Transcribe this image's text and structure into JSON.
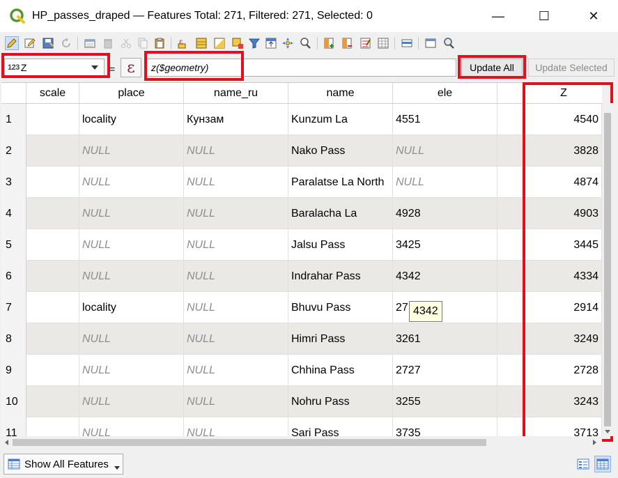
{
  "window": {
    "title": "HP_passes_draped — Features Total: 271, Filtered: 271, Selected: 0",
    "minimize_glyph": "—",
    "maximize_glyph": "☐",
    "close_glyph": "✕"
  },
  "calculator": {
    "field_type": "123",
    "field_name": "Z",
    "equals": "=",
    "expression_button": "ε",
    "expression": "z($geometry)",
    "update_all_label": "Update All",
    "update_selected_label": "Update Selected"
  },
  "table": {
    "columns": [
      "scale",
      "place",
      "name_ru",
      "name",
      "ele",
      "",
      "Z"
    ],
    "rows": [
      {
        "num": "1",
        "scale": "",
        "place": "locality",
        "name_ru": "Кунзам",
        "name": "Kunzum La",
        "ele": "4551",
        "z": "4540"
      },
      {
        "num": "2",
        "scale": "",
        "place": "NULL",
        "name_ru": "NULL",
        "name": "Nako Pass",
        "ele": "NULL",
        "z": "3828"
      },
      {
        "num": "3",
        "scale": "",
        "place": "NULL",
        "name_ru": "NULL",
        "name": "Paralatse La North",
        "ele": "NULL",
        "z": "4874"
      },
      {
        "num": "4",
        "scale": "",
        "place": "NULL",
        "name_ru": "NULL",
        "name": "Baralacha La",
        "ele": "4928",
        "z": "4903"
      },
      {
        "num": "5",
        "scale": "",
        "place": "NULL",
        "name_ru": "NULL",
        "name": "Jalsu Pass",
        "ele": "3425",
        "z": "3445"
      },
      {
        "num": "6",
        "scale": "",
        "place": "NULL",
        "name_ru": "NULL",
        "name": "Indrahar Pass",
        "ele": "4342",
        "z": "4334"
      },
      {
        "num": "7",
        "scale": "",
        "place": "locality",
        "name_ru": "NULL",
        "name": "Bhuvu Pass",
        "ele": "27",
        "z": "2914"
      },
      {
        "num": "8",
        "scale": "",
        "place": "NULL",
        "name_ru": "NULL",
        "name": "Himri Pass",
        "ele": "3261",
        "z": "3249"
      },
      {
        "num": "9",
        "scale": "",
        "place": "NULL",
        "name_ru": "NULL",
        "name": "Chhina Pass",
        "ele": "2727",
        "z": "2728"
      },
      {
        "num": "10",
        "scale": "",
        "place": "NULL",
        "name_ru": "NULL",
        "name": "Nohru Pass",
        "ele": "3255",
        "z": "3243"
      },
      {
        "num": "11",
        "scale": "",
        "place": "NULL",
        "name_ru": "NULL",
        "name": "Sari Pass",
        "ele": "3735",
        "z": "3713"
      }
    ]
  },
  "tooltip": "4342",
  "statusbar": {
    "show_features_label": "Show All Features"
  },
  "colors": {
    "highlight": "#e0101e",
    "alt_row": "#ebe9e6",
    "null_text": "#8e8e8e",
    "qgis_green": "#589632"
  }
}
